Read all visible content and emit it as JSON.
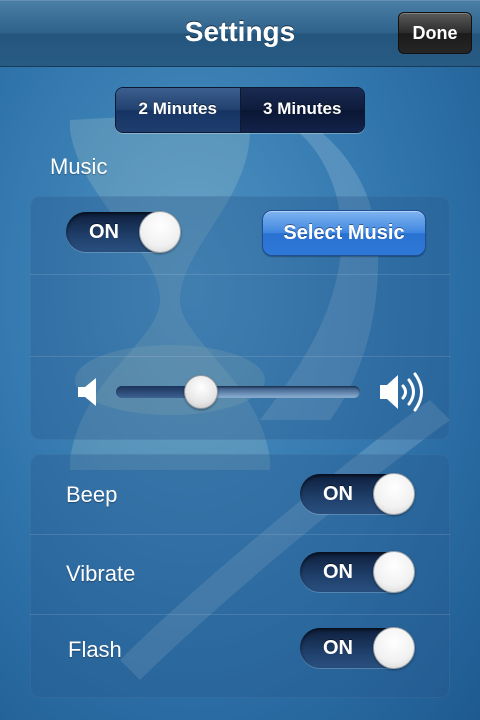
{
  "navbar": {
    "title": "Settings",
    "done_label": "Done"
  },
  "duration": {
    "options": [
      "2 Minutes",
      "3 Minutes"
    ],
    "selected": "3 Minutes"
  },
  "music": {
    "section_label": "Music",
    "toggle_label": "ON",
    "select_music_label": "Select Music",
    "volume_level": 0.32,
    "volume_low_icon": "speaker-low-icon",
    "volume_high_icon": "speaker-high-icon"
  },
  "options": [
    {
      "label": "Beep",
      "toggle_label": "ON"
    },
    {
      "label": "Vibrate",
      "toggle_label": "ON"
    },
    {
      "label": "Flash",
      "toggle_label": "ON"
    }
  ],
  "colors": {
    "background": "#2f74ab",
    "accent_button": "#3f86e0",
    "navbar": "#2f628a"
  }
}
